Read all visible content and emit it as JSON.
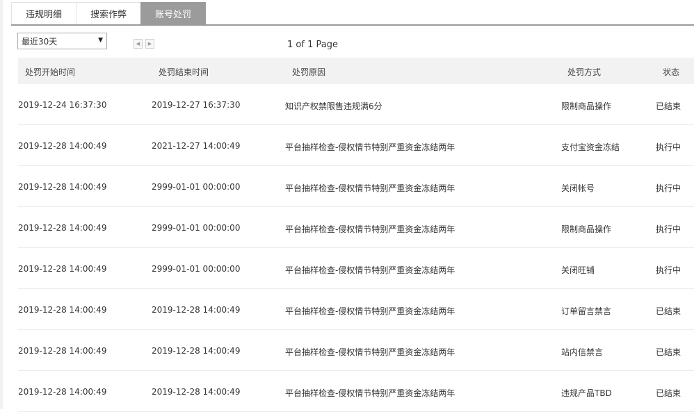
{
  "tabs": [
    {
      "label": "违规明细"
    },
    {
      "label": "搜索作弊"
    },
    {
      "label": "账号处罚"
    }
  ],
  "filter": {
    "selected": "最近30天"
  },
  "pager": {
    "info": "1 of 1 Page"
  },
  "table": {
    "headers": [
      "处罚开始时间",
      "处罚结束时间",
      "处罚原因",
      "处罚方式",
      "状态"
    ],
    "rows": [
      [
        "2019-12-24 16:37:30",
        "2019-12-27 16:37:30",
        "知识产权禁限售违规满6分",
        "限制商品操作",
        "已结束"
      ],
      [
        "2019-12-28 14:00:49",
        "2021-12-27 14:00:49",
        "平台抽样检查-侵权情节特别严重资金冻结两年",
        "支付宝资金冻结",
        "执行中"
      ],
      [
        "2019-12-28 14:00:49",
        "2999-01-01 00:00:00",
        "平台抽样检查-侵权情节特别严重资金冻结两年",
        "关闭帐号",
        "执行中"
      ],
      [
        "2019-12-28 14:00:49",
        "2999-01-01 00:00:00",
        "平台抽样检查-侵权情节特别严重资金冻结两年",
        "限制商品操作",
        "执行中"
      ],
      [
        "2019-12-28 14:00:49",
        "2999-01-01 00:00:00",
        "平台抽样检查-侵权情节特别严重资金冻结两年",
        "关闭旺铺",
        "执行中"
      ],
      [
        "2019-12-28 14:00:49",
        "2019-12-28 14:00:49",
        "平台抽样检查-侵权情节特别严重资金冻结两年",
        "订单留言禁言",
        "已结束"
      ],
      [
        "2019-12-28 14:00:49",
        "2019-12-28 14:00:49",
        "平台抽样检查-侵权情节特别严重资金冻结两年",
        "站内信禁言",
        "已结束"
      ],
      [
        "2019-12-28 14:00:49",
        "2019-12-28 14:00:49",
        "平台抽样检查-侵权情节特别严重资金冻结两年",
        "违规产品TBD",
        "已结束"
      ]
    ]
  }
}
